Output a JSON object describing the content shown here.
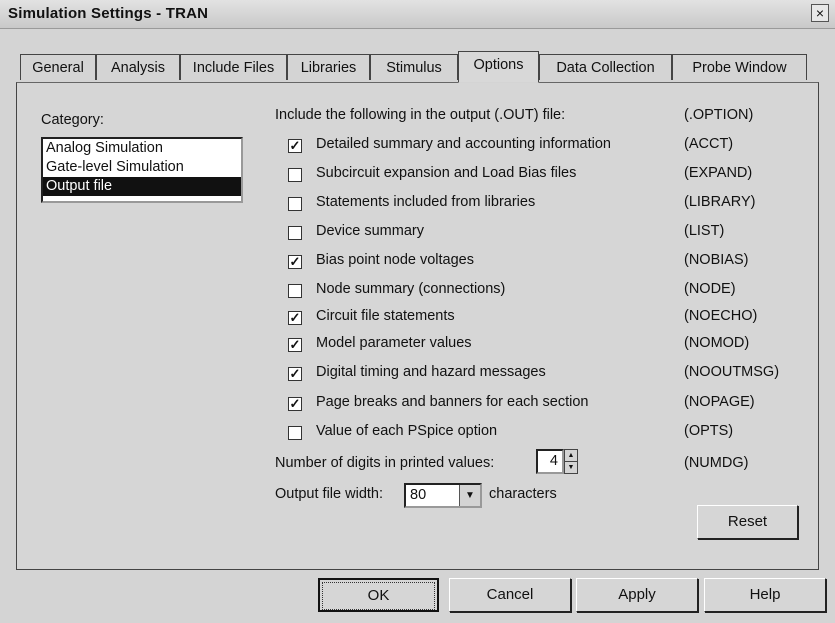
{
  "window": {
    "title": "Simulation Settings - TRAN",
    "close_glyph": "×"
  },
  "tabs": [
    {
      "label": "General"
    },
    {
      "label": "Analysis"
    },
    {
      "label": "Include Files"
    },
    {
      "label": "Libraries"
    },
    {
      "label": "Stimulus"
    },
    {
      "label": "Options",
      "active": true
    },
    {
      "label": "Data Collection"
    },
    {
      "label": "Probe Window"
    }
  ],
  "category": {
    "label": "Category:",
    "items": [
      {
        "label": "Analog Simulation"
      },
      {
        "label": "Gate-level Simulation"
      },
      {
        "label": "Output file",
        "selected": true
      }
    ]
  },
  "output": {
    "heading": "Include the following in the output (.OUT) file:",
    "heading_code": "(.OPTION)",
    "options": [
      {
        "label": "Detailed summary and accounting information",
        "code": "(ACCT)",
        "checked": true
      },
      {
        "label": "Subcircuit expansion and Load Bias files",
        "code": "(EXPAND)",
        "checked": false
      },
      {
        "label": "Statements included from libraries",
        "code": "(LIBRARY)",
        "checked": false
      },
      {
        "label": "Device summary",
        "code": "(LIST)",
        "checked": false
      },
      {
        "label": "Bias point node voltages",
        "code": "(NOBIAS)",
        "checked": true
      },
      {
        "label": "Node summary (connections)",
        "code": "(NODE)",
        "checked": false
      },
      {
        "label": "Circuit file statements",
        "code": "(NOECHO)",
        "checked": true
      },
      {
        "label": "Model parameter values",
        "code": "(NOMOD)",
        "checked": true
      },
      {
        "label": "Digital timing and hazard messages",
        "code": "(NOOUTMSG)",
        "checked": true
      },
      {
        "label": "Page breaks and banners for each section",
        "code": "(NOPAGE)",
        "checked": true
      },
      {
        "label": "Value of each PSpice option",
        "code": "(OPTS)",
        "checked": false
      }
    ],
    "check_glyph": "✓",
    "digits_label": "Number of digits in printed values:",
    "digits_value": "4",
    "digits_code": "(NUMDG)",
    "width_label": "Output file width:",
    "width_value": "80",
    "width_suffix": "characters",
    "reset_label": "Reset"
  },
  "buttons": {
    "ok": "OK",
    "cancel": "Cancel",
    "apply": "Apply",
    "help": "Help"
  }
}
